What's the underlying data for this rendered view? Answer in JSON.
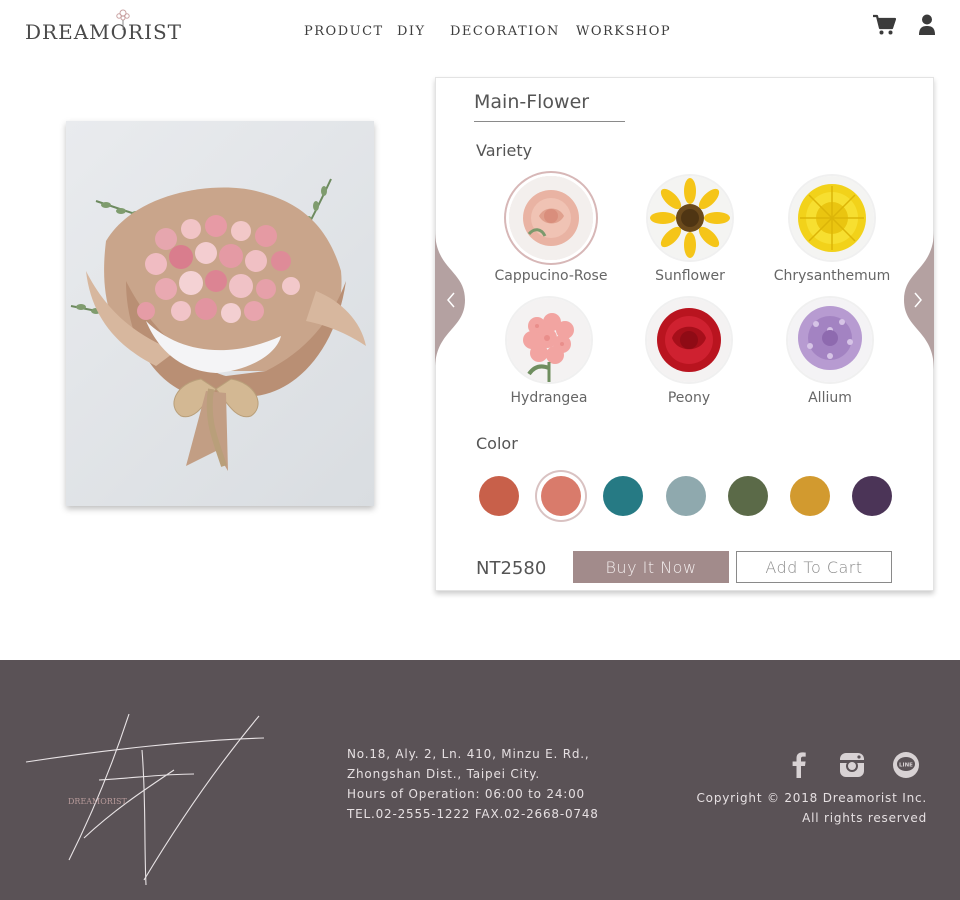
{
  "header": {
    "logo_text": "DREAMORIST",
    "nav": [
      {
        "label": "PRODUCT"
      },
      {
        "label": "DIY"
      },
      {
        "label": "DECORATION"
      },
      {
        "label": "WORKSHOP"
      }
    ],
    "icons": [
      "cart-icon",
      "user-icon"
    ]
  },
  "panel": {
    "title": "Main-Flower",
    "variety_label": "Variety",
    "varieties": [
      {
        "name": "Cappucino-Rose",
        "selected": true
      },
      {
        "name": "Sunflower",
        "selected": false
      },
      {
        "name": "Chrysanthemum",
        "selected": false
      },
      {
        "name": "Hydrangea",
        "selected": false
      },
      {
        "name": "Peony",
        "selected": false
      },
      {
        "name": "Allium",
        "selected": false
      }
    ],
    "color_label": "Color",
    "colors": [
      {
        "hex": "#c8604a",
        "selected": false
      },
      {
        "hex": "#d97b6b",
        "selected": true
      },
      {
        "hex": "#267a84",
        "selected": false
      },
      {
        "hex": "#8fa9ae",
        "selected": false
      },
      {
        "hex": "#5b6a48",
        "selected": false
      },
      {
        "hex": "#d29a2f",
        "selected": false
      },
      {
        "hex": "#4b3457",
        "selected": false
      }
    ],
    "price": "NT2580",
    "buy_label": "Buy It Now",
    "cart_label": "Add To Cart"
  },
  "footer": {
    "logo_text": "DREAMORIST",
    "address_lines": [
      "No.18, Aly. 2, Ln. 410, Minzu E. Rd.,",
      "Zhongshan Dist., Taipei City.",
      "Hours of Operation: 06:00 to 24:00",
      "TEL.02-2555-1222 FAX.02-2668-0748"
    ],
    "social": [
      "facebook-icon",
      "instagram-icon",
      "line-icon"
    ],
    "line_badge": "LINE",
    "copyright_lines": [
      "Copyright © 2018 Dreamorist Inc.",
      "All rights reserved"
    ]
  },
  "colors": {
    "accent": "#a28b8b",
    "footer_bg": "#5a5256"
  }
}
